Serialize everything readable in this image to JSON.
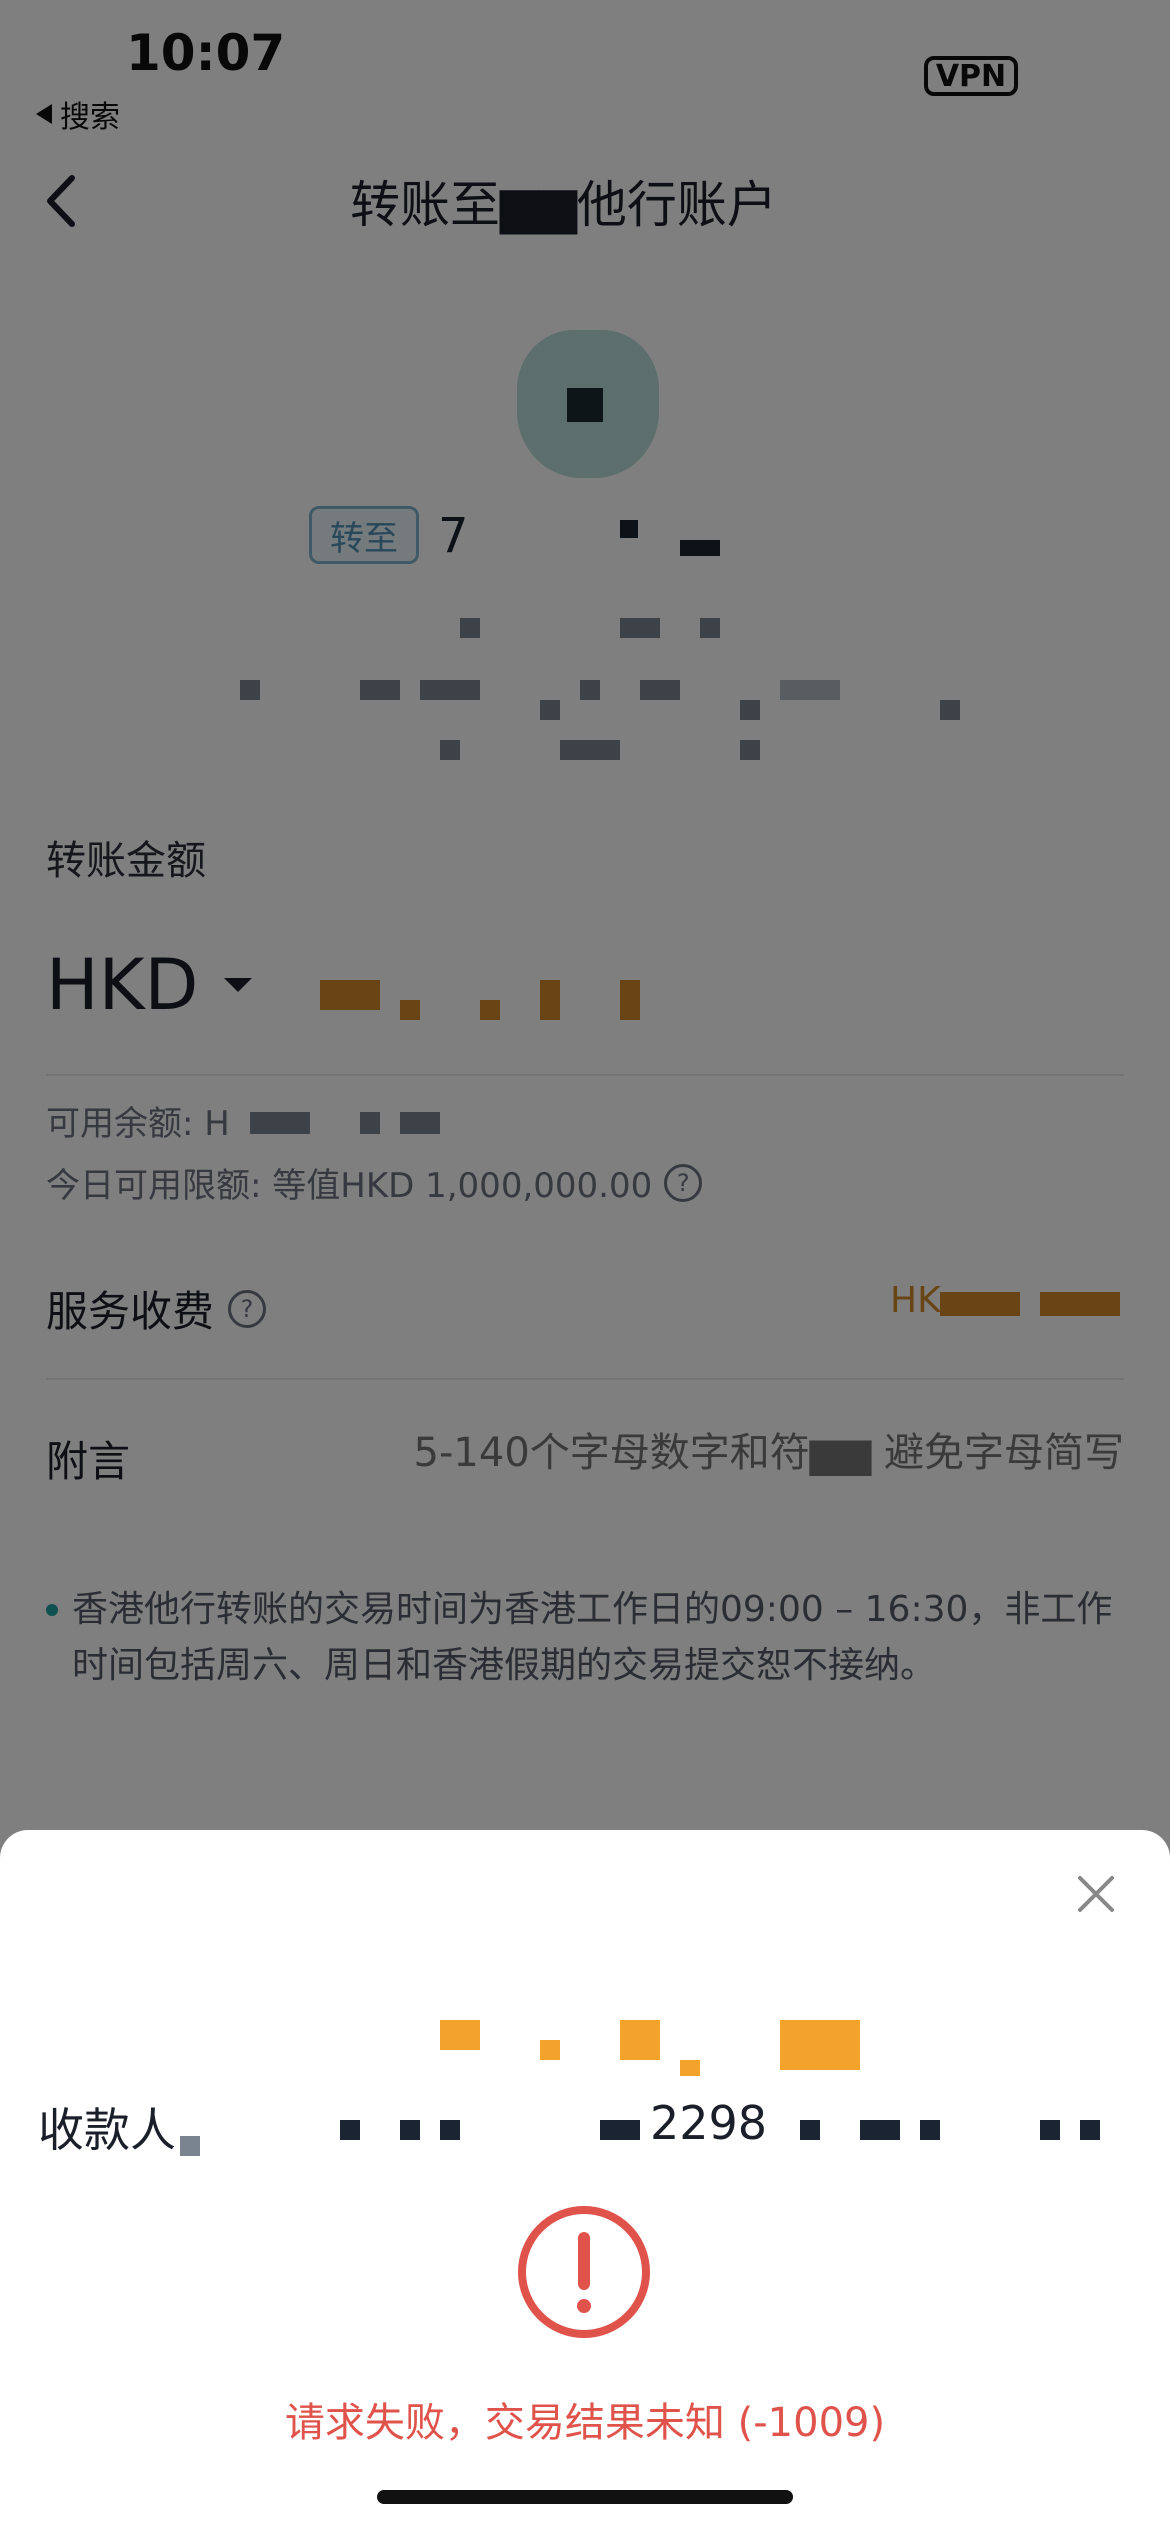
{
  "status_bar": {
    "time": "10:07",
    "back_app": "搜索",
    "vpn": "VPN"
  },
  "nav": {
    "title": "转账至▆▆他行账户"
  },
  "recipient": {
    "tag": "转至",
    "name_prefix": "7"
  },
  "amount": {
    "label": "转账金额",
    "currency": "HKD",
    "available_prefix": "可用余额: H",
    "daily_limit": "今日可用限额: 等值HKD 1,000,000.00"
  },
  "fee": {
    "label": "服务收费",
    "value_prefix": "HK"
  },
  "memo": {
    "label": "附言",
    "placeholder": "5-140个字母数字和符▆▆ 避免字母简写"
  },
  "notice": {
    "text": "香港他行转账的交易时间为香港工作日的09:00 – 16:30，非工作时间包括周六、周日和香港假期的交易提交恕不接纳。"
  },
  "sheet": {
    "payee_label": "收款人",
    "payee_value_fragment": "2298",
    "error_message": "请求失败，交易结果未知 (-1009)"
  },
  "colors": {
    "error": "#e0534b",
    "accent_orange": "#d38a2a",
    "tag_blue": "#4f90b5"
  }
}
